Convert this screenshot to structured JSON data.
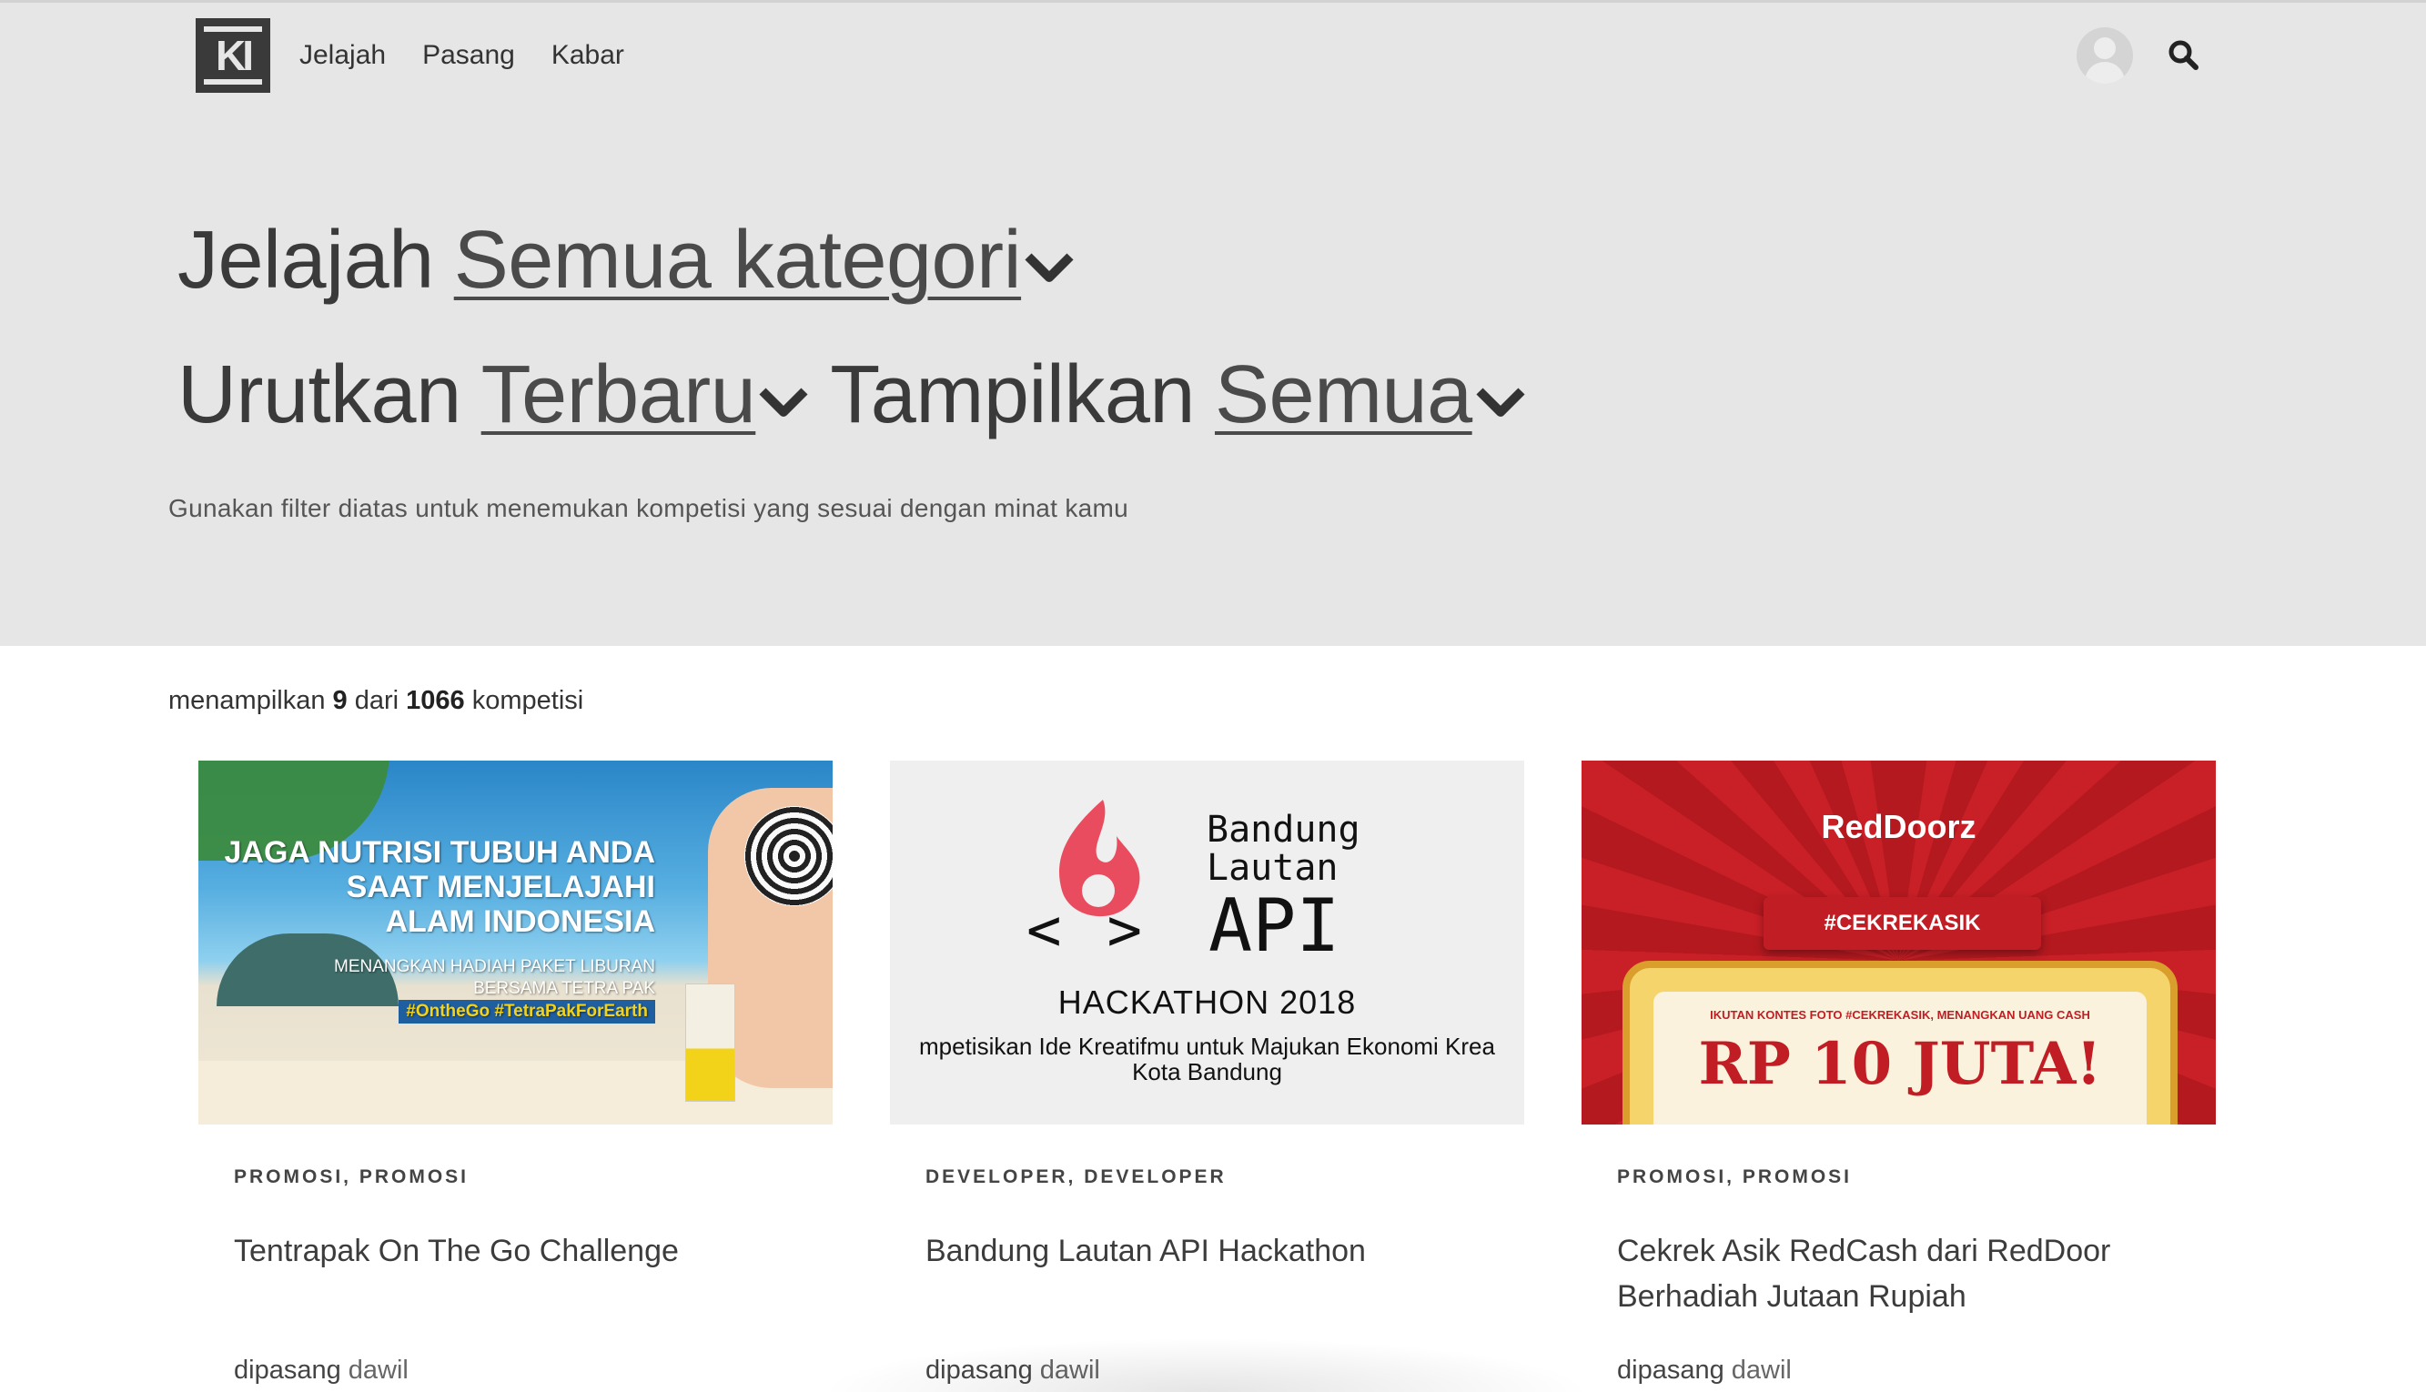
{
  "nav": {
    "logo_text": "KI",
    "links": [
      "Jelajah",
      "Pasang",
      "Kabar"
    ],
    "avatar_icon": "user-avatar-icon",
    "search_icon": "search-icon"
  },
  "filters": {
    "line1_prefix": "Jelajah",
    "category_value": "Semua kategori",
    "line2_sort_prefix": "Urutkan",
    "sort_value": "Terbaru",
    "show_prefix": "Tampilkan",
    "show_value": "Semua",
    "hint": "Gunakan filter diatas untuk menemukan kompetisi yang sesuai dengan minat kamu"
  },
  "results": {
    "prefix": "menampilkan",
    "shown": "9",
    "middle": "dari",
    "total": "1066",
    "suffix": "kompetisi"
  },
  "cards": [
    {
      "category": "PROMOSI, PROMOSI",
      "title": "Tentrapak On The Go Challenge",
      "posted_prefix": "dipasang",
      "author": "dawil",
      "image": {
        "headline": "JAGA NUTRISI TUBUH ANDA\nSAAT MENJELAJAHI\nALAM INDONESIA",
        "sub": "MENANGKAN HADIAH PAKET LIBURAN\nBERSAMA TETRA PAK",
        "hashtags": "#OntheGo #TetraPakForEarth"
      }
    },
    {
      "category": "DEVELOPER, DEVELOPER",
      "title": "Bandung Lautan API Hackathon",
      "posted_prefix": "dipasang",
      "author": "dawil",
      "image": {
        "brand": "Bandung\nLautan",
        "api": "API",
        "code": "<>",
        "event": "HACKATHON 2018",
        "tagline": "mpetisikan Ide Kreatifmu untuk Majukan Ekonomi Krea\nKota Bandung"
      }
    },
    {
      "category": "PROMOSI, PROMOSI",
      "title": "Cekrek Asik RedCash dari RedDoor Berhadiah Jutaan Rupiah",
      "posted_prefix": "dipasang",
      "author": "dawil",
      "image": {
        "brand": "RedDoorz",
        "tag": "#CEKREKASIK",
        "small": "IKUTAN KONTES FOTO #CEKREKASIK, MENANGKAN UANG CASH",
        "big": "RP 10 JUTA!"
      }
    }
  ],
  "colors": {
    "hero_bg": "#e6e6e6",
    "text_dark": "#3a3a3a",
    "api_flame": "#ea4c5f",
    "reddoorz_red": "#c11d25"
  }
}
